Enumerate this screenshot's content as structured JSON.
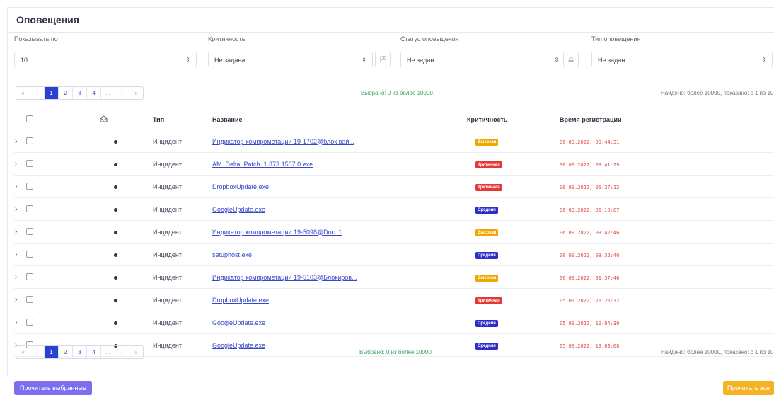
{
  "header": {
    "title": "Оповещения"
  },
  "filters": [
    {
      "label": "Показывать по",
      "value": "10"
    },
    {
      "label": "Критичность",
      "value": "Не задана"
    },
    {
      "label": "Статус оповещения",
      "value": "Не задан"
    },
    {
      "label": "Тип оповещения",
      "value": "Не задан"
    }
  ],
  "pagination": {
    "first": "«",
    "prev": "‹",
    "pages": [
      "1",
      "2",
      "3",
      "4"
    ],
    "ellipsis": "...",
    "next": "›",
    "last": "»"
  },
  "selection": {
    "prefix": "Выбрано: 0 из ",
    "link": "более",
    "suffix": " 10000"
  },
  "found": {
    "prefix": "Найдено: ",
    "link": "более",
    "suffix": " 10000, показано: с 1 по 10"
  },
  "table": {
    "columns": {
      "type": "Тип",
      "name": "Название",
      "criticality": "Критичность",
      "time": "Время регистрации"
    },
    "rows": [
      {
        "type": "Инцидент",
        "name": "Индикатор компрометации 19-1702@блок вай...",
        "criticality": "Высокая",
        "time": "06.09.2022, 09:44:31"
      },
      {
        "type": "Инцидент",
        "name": "AM_Delta_Patch_1.373.1567.0.exe",
        "criticality": "Критичная",
        "time": "06.09.2022, 09:41:29"
      },
      {
        "type": "Инцидент",
        "name": "DropboxUpdate.exe",
        "criticality": "Критичная",
        "time": "06.09.2022, 05:27:12"
      },
      {
        "type": "Инцидент",
        "name": "GoogleUpdate.exe",
        "criticality": "Средняя",
        "time": "06.09.2022, 05:10:07"
      },
      {
        "type": "Инцидент",
        "name": "Индикатор компрометации 19-5098@Doc_1",
        "criticality": "Высокая",
        "time": "06.09.2022, 03:42:46"
      },
      {
        "type": "Инцидент",
        "name": "setuphost.exe",
        "criticality": "Средняя",
        "time": "06.09.2022, 03:32:40"
      },
      {
        "type": "Инцидент",
        "name": "Индикатор компрометации 19-5103@Блокиров...",
        "criticality": "Высокая",
        "time": "06.09.2022, 01:57:46"
      },
      {
        "type": "Инцидент",
        "name": "DropboxUpdate.exe",
        "criticality": "Критичная",
        "time": "05.09.2022, 21:26:32"
      },
      {
        "type": "Инцидент",
        "name": "GoogleUpdate.exe",
        "criticality": "Средняя",
        "time": "05.09.2022, 19:04:39"
      },
      {
        "type": "Инцидент",
        "name": "GoogleUpdate.exe",
        "criticality": "Средняя",
        "time": "05.09.2022, 19:03:08"
      }
    ]
  },
  "colors": {
    "Высокая": "#f0a800",
    "Критичная": "#e53935",
    "Средняя": "#2b2fc7"
  },
  "buttons": {
    "read_selected": "Прочитать выбранные",
    "read_all": "Прочитать все"
  }
}
